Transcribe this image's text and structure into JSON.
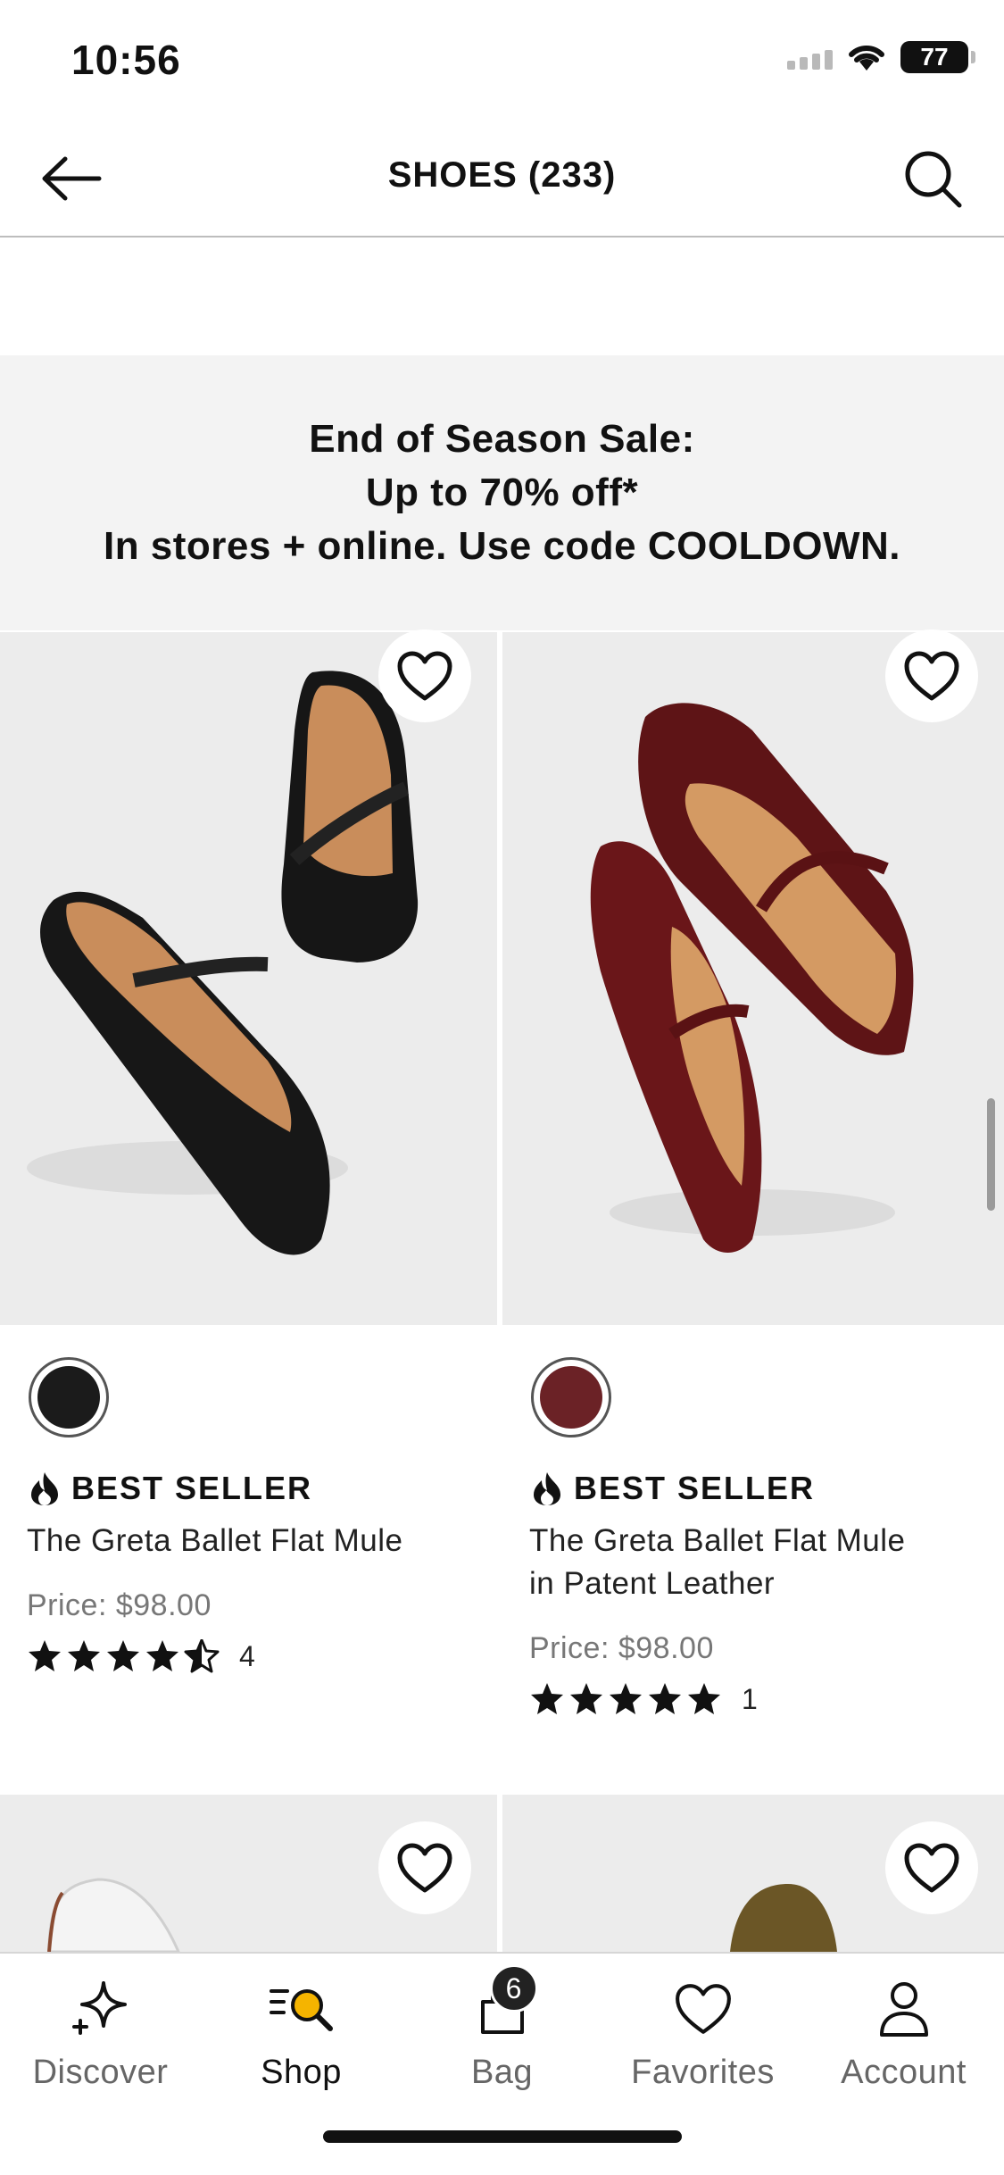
{
  "status_bar": {
    "time": "10:56",
    "battery": "77"
  },
  "header": {
    "title": "SHOES (233)"
  },
  "promo": {
    "line1": "End of Season Sale:",
    "line2": "Up to 70% off*",
    "line3": "In stores + online. Use code COOLDOWN."
  },
  "products": [
    {
      "badge": "BEST SELLER",
      "name": "The Greta Ballet Flat Mule",
      "price": "Price: $98.00",
      "rating": 4.5,
      "review_count": "4",
      "swatch_color": "#1b1b1b"
    },
    {
      "badge": "BEST SELLER",
      "name_line1": "The Greta Ballet Flat Mule",
      "name_line2": "in Patent Leather",
      "price": "Price: $98.00",
      "rating": 5,
      "review_count": "1",
      "swatch_color": "#6b2226"
    }
  ],
  "tabs": [
    {
      "label": "Discover",
      "icon": "sparkle-icon"
    },
    {
      "label": "Shop",
      "icon": "shop-search-icon"
    },
    {
      "label": "Bag",
      "icon": "bag-icon",
      "badge": "6"
    },
    {
      "label": "Favorites",
      "icon": "heart-icon"
    },
    {
      "label": "Account",
      "icon": "person-icon"
    }
  ],
  "colors": {
    "accent": "#111111",
    "banner_bg": "#f3f3f3",
    "image_bg": "#ececec"
  }
}
